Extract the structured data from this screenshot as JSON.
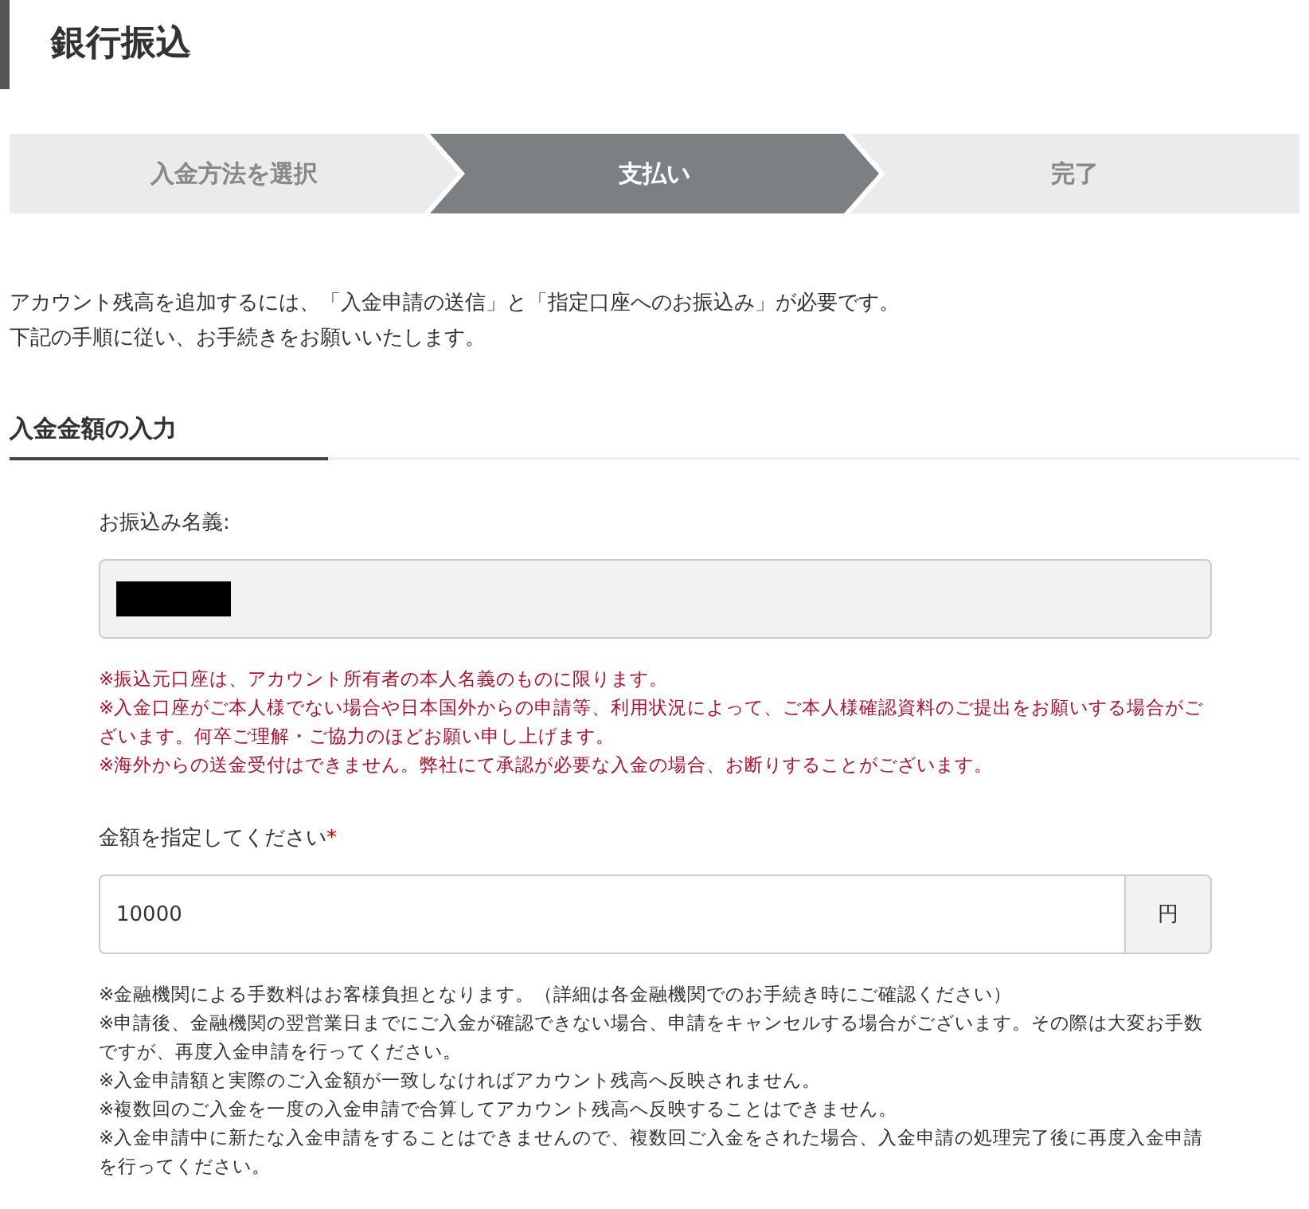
{
  "page_title": "銀行振込",
  "steps": [
    {
      "label": "入金方法を選択",
      "selected": false
    },
    {
      "label": "支払い",
      "selected": true
    },
    {
      "label": "完了",
      "selected": false
    }
  ],
  "intro": [
    "アカウント残高を追加するには、「入金申請の送信」と「指定口座へのお振込み」が必要です。",
    "下記の手順に従い、お手続きをお願いいたします。"
  ],
  "section_title": "入金金額の入力",
  "name_field": {
    "label": "お振込み名義:",
    "value_redacted": true
  },
  "name_notes": [
    "※振込元口座は、アカウント所有者の本人名義のものに限ります。",
    "※入金口座がご本人様でない場合や日本国外からの申請等、利用状況によって、ご本人様確認資料のご提出をお願いする場合がございます。何卒ご理解・ご協力のほどお願い申し上げます。",
    "※海外からの送金受付はできません。弊社にて承認が必要な入金の場合、お断りすることがございます。"
  ],
  "amount_field": {
    "label": "金額を指定してください",
    "required_mark": "*",
    "value": "10000",
    "unit": "円"
  },
  "amount_notes": [
    "※金融機関による手数料はお客様負担となります。（詳細は各金融機関でのお手続き時にご確認ください）",
    "※申請後、金融機関の翌営業日までにご入金が確認できない場合、申請をキャンセルする場合がございます。その際は大変お手数ですが、再度入金申請を行ってください。",
    "※入金申請額と実際のご入金額が一致しなければアカウント残高へ反映されません。",
    "※複数回のご入金を一度の入金申請で合算してアカウント残高へ反映することはできません。",
    "※入金申請中に新たな入金申請をすることはできませんので、複数回ご入金をされた場合、入金申請の処理完了後に再度入金申請を行ってください。"
  ]
}
